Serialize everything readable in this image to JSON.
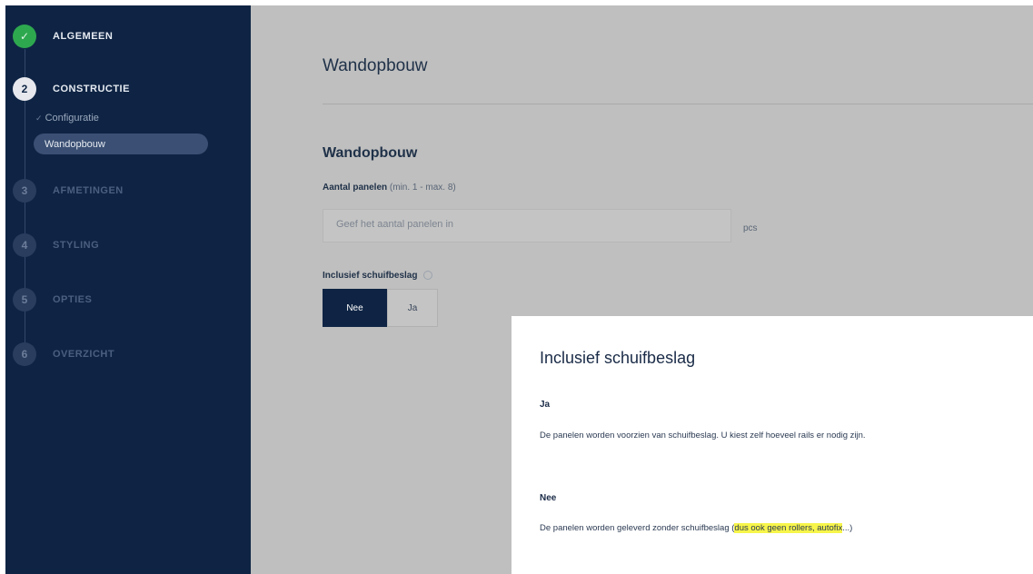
{
  "sidebar": {
    "steps": [
      {
        "number": "✓",
        "label": "ALGEMEEN"
      },
      {
        "number": "2",
        "label": "CONSTRUCTIE"
      },
      {
        "number": "3",
        "label": "AFMETINGEN"
      },
      {
        "number": "4",
        "label": "STYLING"
      },
      {
        "number": "5",
        "label": "OPTIES"
      },
      {
        "number": "6",
        "label": "OVERZICHT"
      }
    ],
    "sub_items": [
      {
        "label": "Configuratie"
      },
      {
        "label": "Wandopbouw"
      }
    ]
  },
  "main": {
    "page_title": "Wandopbouw",
    "section_title": "Wandopbouw",
    "panels_field": {
      "label": "Aantal panelen",
      "hint": "(min. 1 - max. 8)",
      "placeholder": "Geef het aantal panelen in",
      "unit": "pcs"
    },
    "sliding_toggle": {
      "label": "Inclusief schuifbeslag",
      "options": [
        "Nee",
        "Ja"
      ],
      "selected": "Nee"
    }
  },
  "popup": {
    "title": "Inclusief schuifbeslag",
    "options": [
      {
        "heading": "Ja",
        "text": "De panelen worden voorzien van schuifbeslag. U kiest zelf hoeveel rails er nodig zijn."
      },
      {
        "heading": "Nee",
        "text_before": "De panelen worden geleverd zonder schuifbeslag (",
        "text_highlight": "dus ook geen rollers, autofix",
        "text_after": "...)"
      }
    ],
    "highlight_color": "#f7f54a"
  },
  "colors": {
    "sidebar_bg": "#0f2444",
    "done_green": "#2ea84f",
    "main_overlay": "#bfbfbf"
  }
}
